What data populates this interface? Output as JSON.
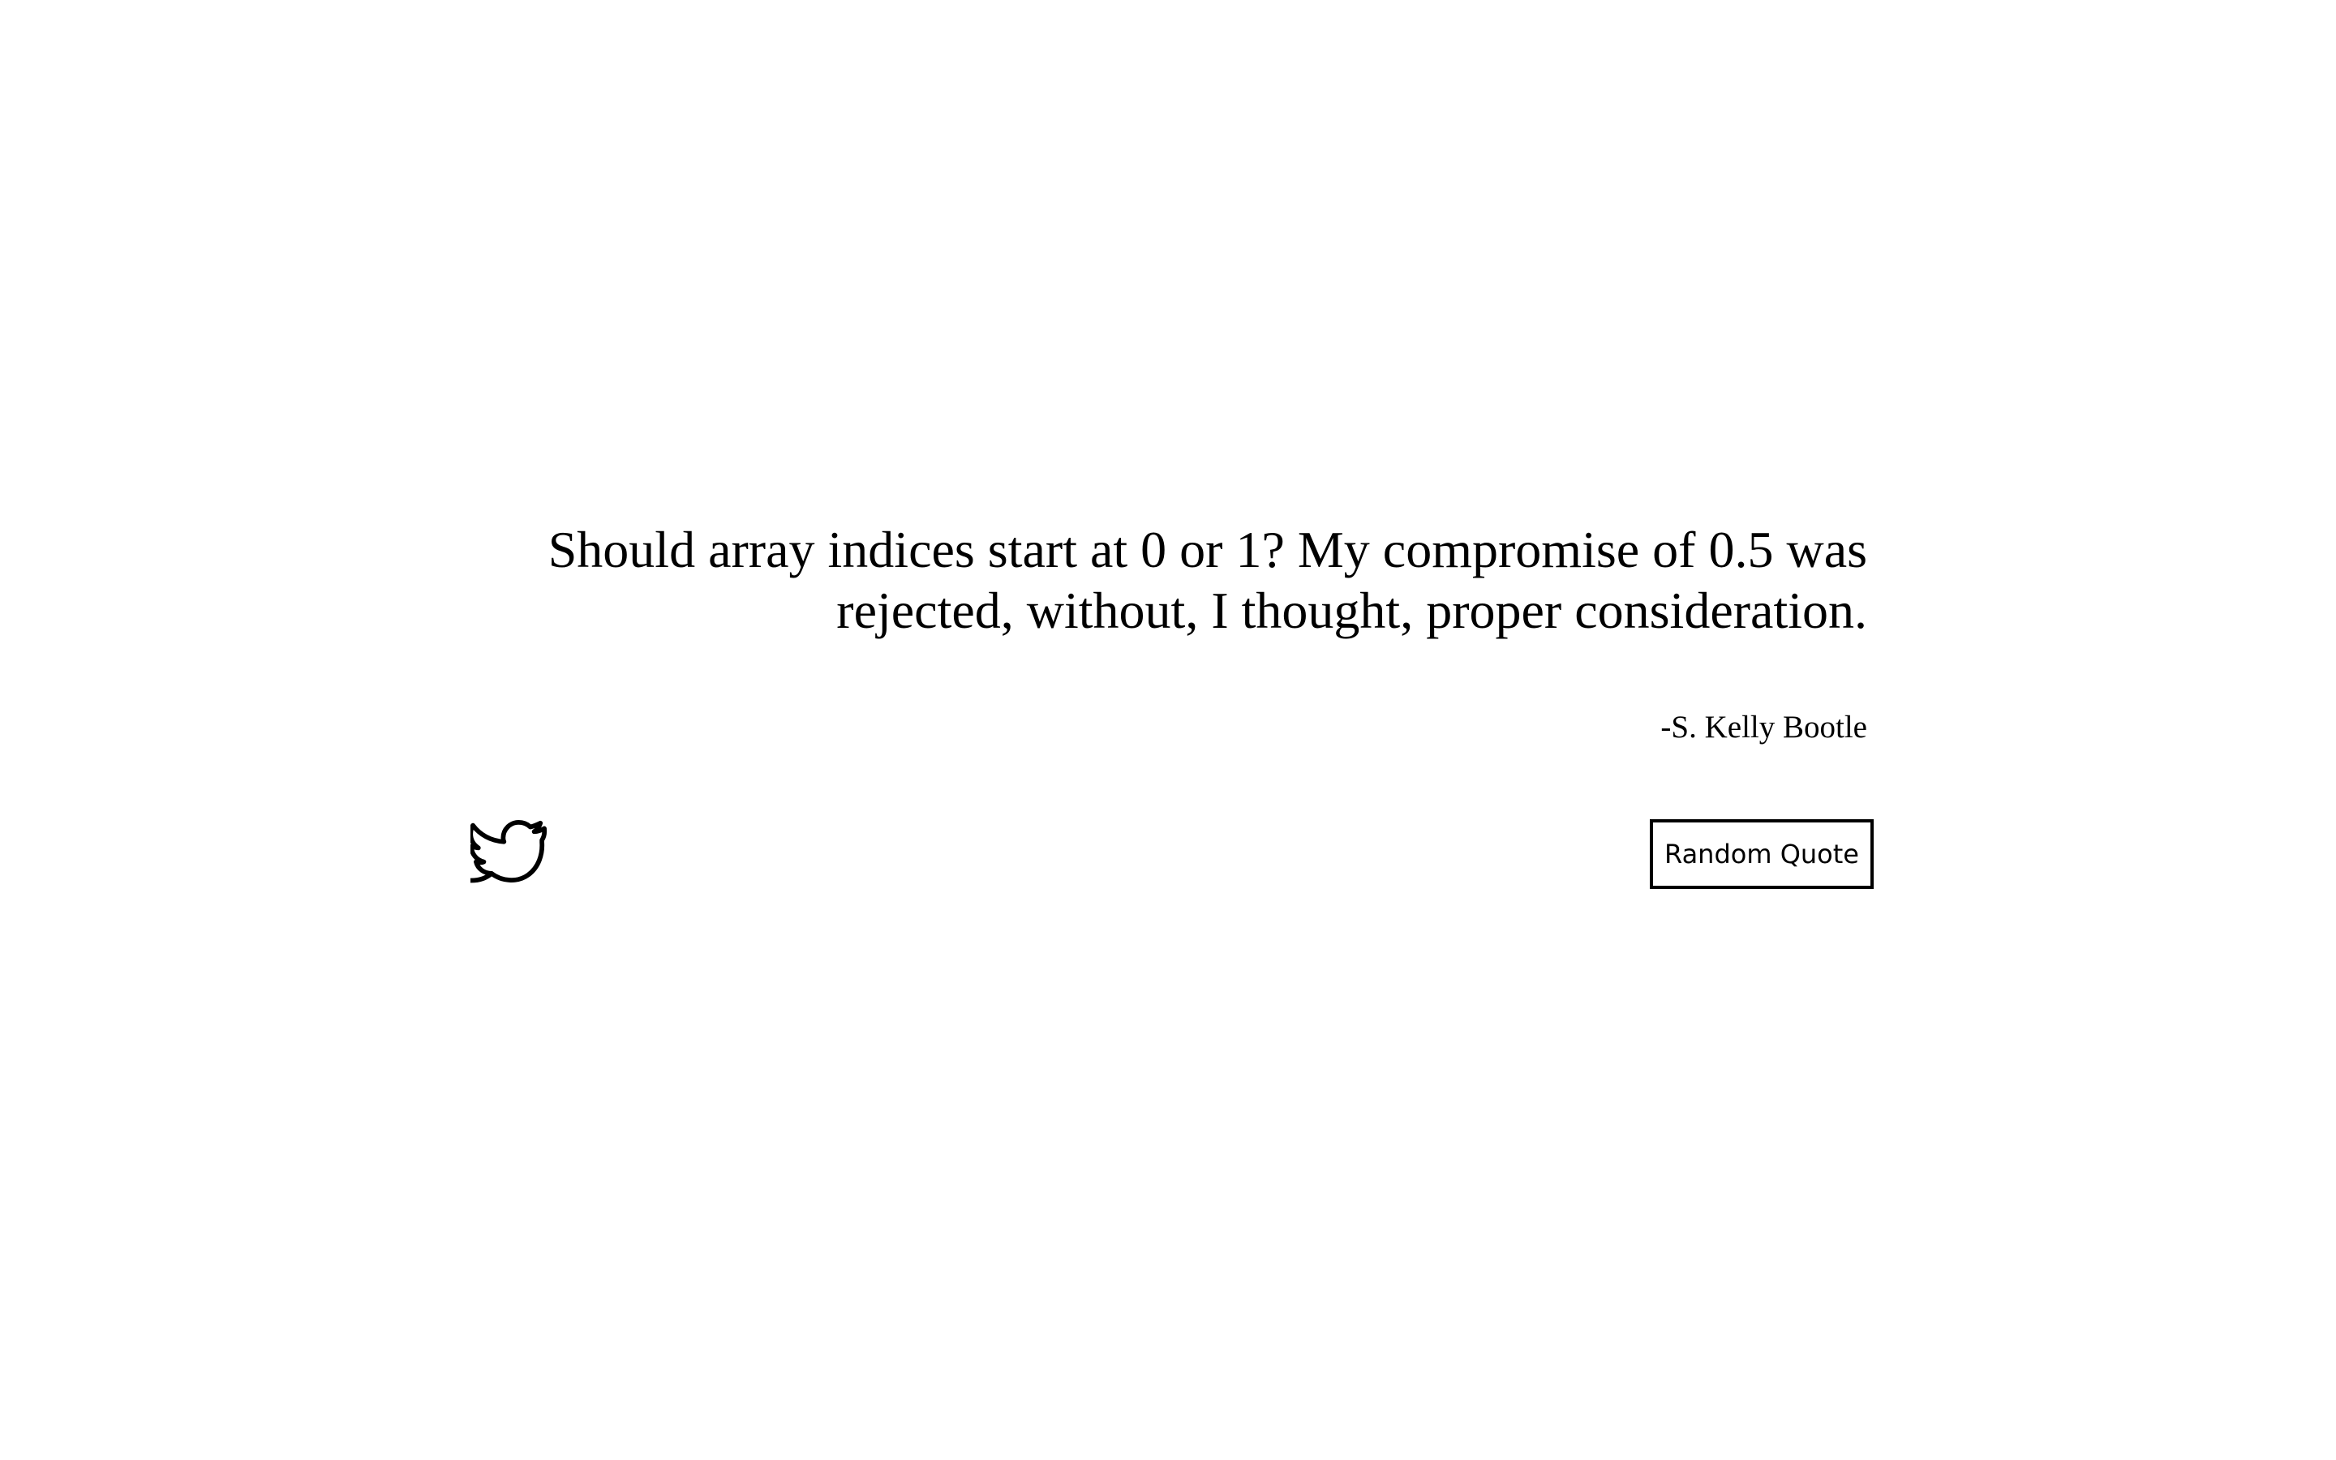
{
  "quote": {
    "text": "Should array indices start at 0 or 1? My compromise of 0.5 was rejected, without, I thought, proper consideration.",
    "author": "-S. Kelly Bootle"
  },
  "actions": {
    "tweet_icon": "twitter-bird-icon",
    "random_label": "Random Quote"
  },
  "colors": {
    "background": "#ffffff",
    "text": "#000000",
    "button_border": "#000000"
  }
}
